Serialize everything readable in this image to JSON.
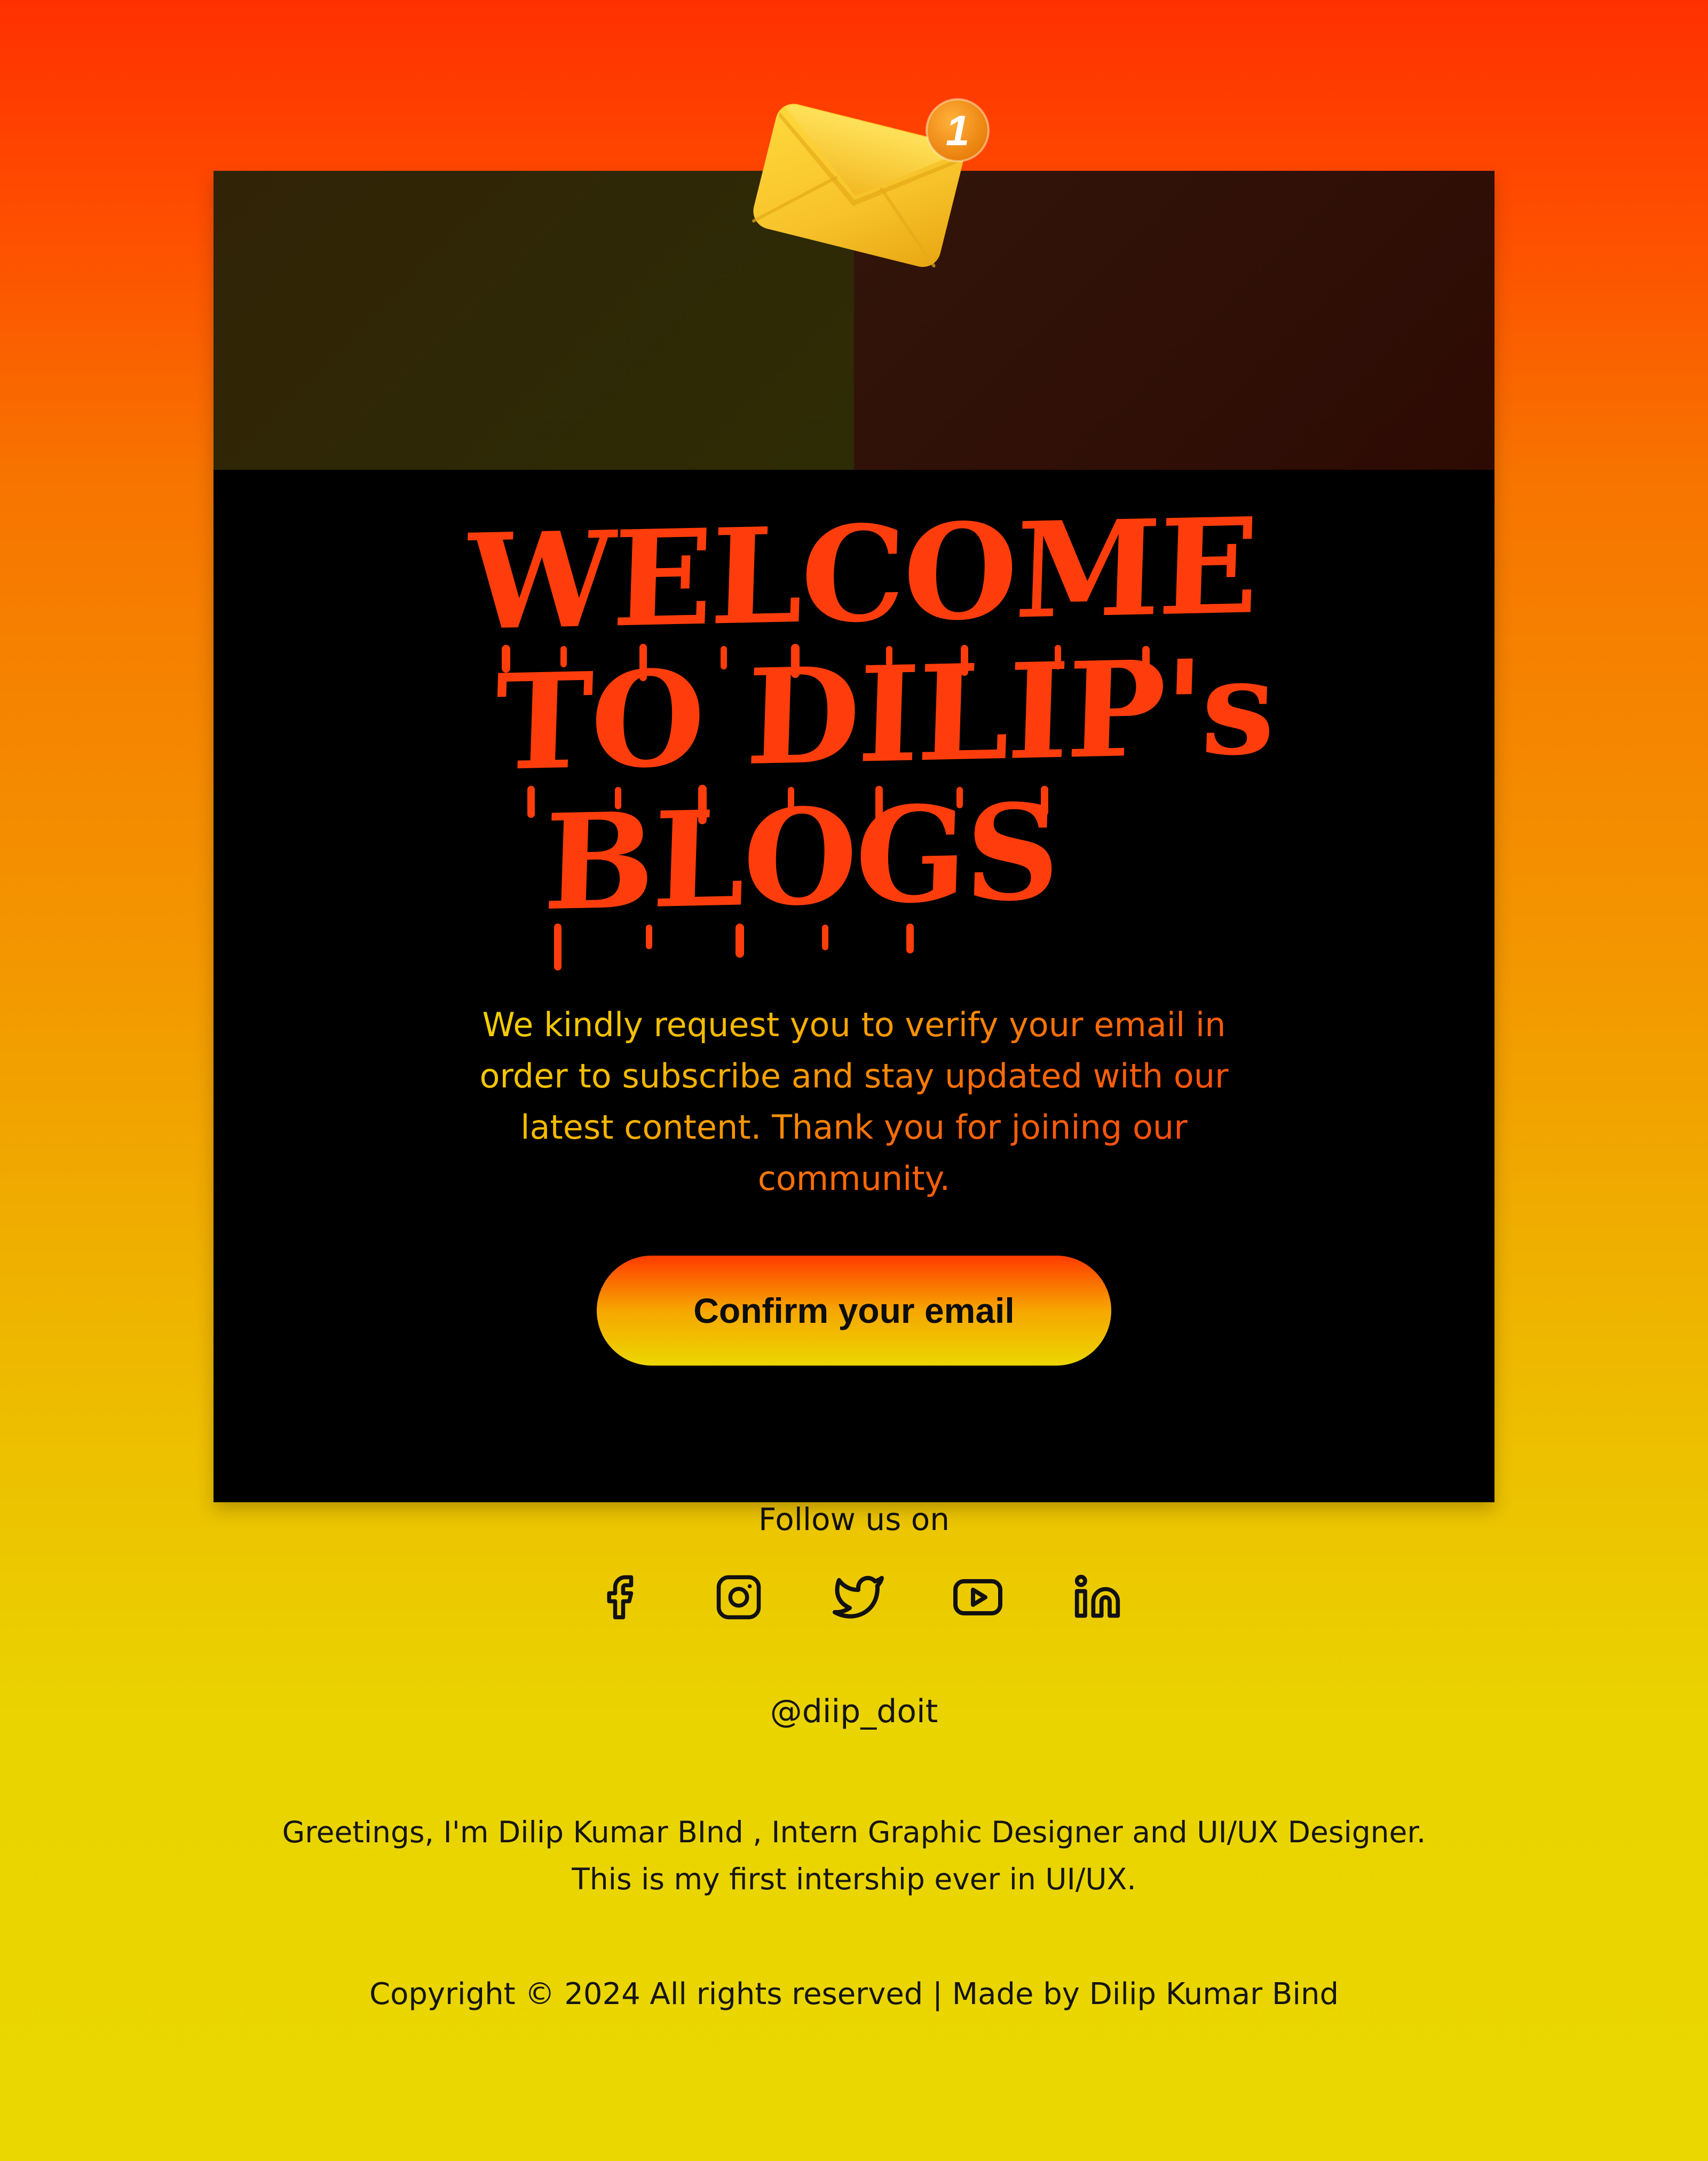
{
  "hero": {
    "title_lines": [
      "WELCOME",
      "TO DILIP's",
      "BLOGS"
    ],
    "notification_count": "1",
    "icon": "mail-notification-icon"
  },
  "intro": {
    "text": "We kindly request you to verify your email in order to subscribe and stay updated with our latest content. Thank you for joining our community."
  },
  "cta": {
    "confirm_label": "Confirm your email"
  },
  "footer": {
    "follow_label": "Follow us on",
    "social_icons": [
      "facebook-icon",
      "instagram-icon",
      "twitter-icon",
      "youtube-icon",
      "linkedin-icon"
    ],
    "handle": "@diip_doit",
    "bio_lines": [
      "Greetings, I'm Dilip Kumar BInd , Intern Graphic Designer and UI/UX Designer.",
      "This is my first intership ever in UI/UX."
    ],
    "copyright": "Copyright © 2024 All rights reserved | Made by Dilip Kumar Bind"
  },
  "colors": {
    "background_top": "#ff3000",
    "background_bottom": "#ead600",
    "card": "#000000",
    "title": "#ff3d0c",
    "envelope": "#f7c936",
    "badge": "#f29012"
  }
}
